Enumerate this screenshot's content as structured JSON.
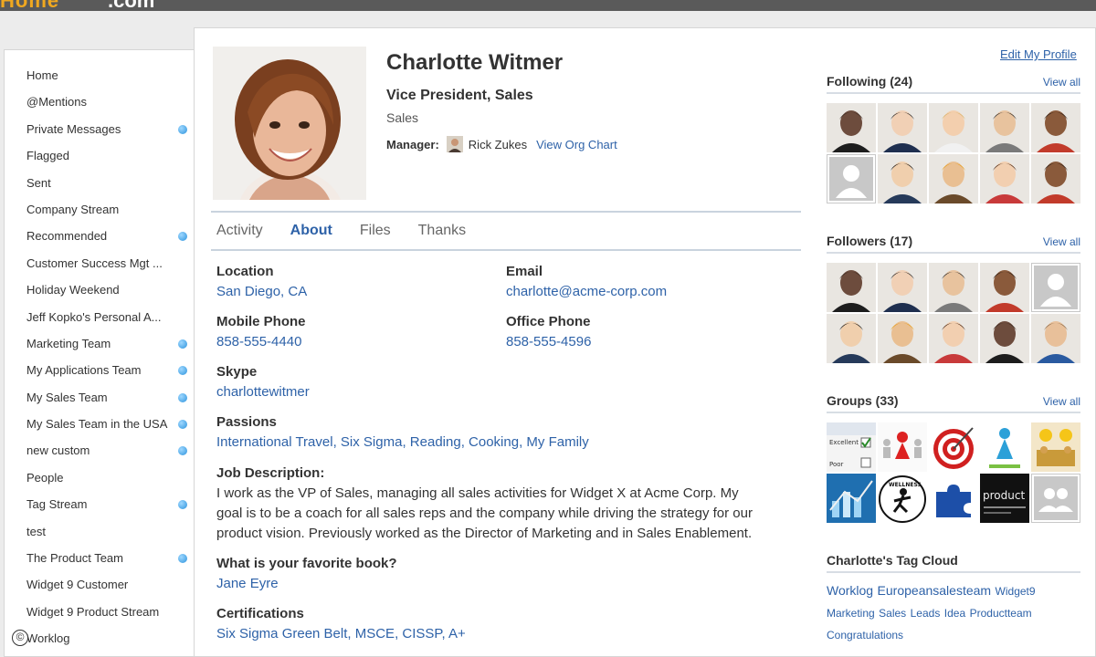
{
  "brand": {
    "left": "Home",
    "right": ".com"
  },
  "sidebar": {
    "items": [
      {
        "label": "Home",
        "dot": false
      },
      {
        "label": "@Mentions",
        "dot": false
      },
      {
        "label": "Private Messages",
        "dot": true
      },
      {
        "label": "Flagged",
        "dot": false
      },
      {
        "label": "Sent",
        "dot": false
      },
      {
        "label": "Company Stream",
        "dot": false
      },
      {
        "label": "Recommended",
        "dot": true
      },
      {
        "label": "Customer Success Mgt ...",
        "dot": false
      },
      {
        "label": "Holiday Weekend",
        "dot": false
      },
      {
        "label": "Jeff Kopko's Personal A...",
        "dot": false
      },
      {
        "label": "Marketing Team",
        "dot": true
      },
      {
        "label": "My Applications Team",
        "dot": true
      },
      {
        "label": "My Sales Team",
        "dot": true
      },
      {
        "label": "My Sales Team in the USA",
        "dot": true
      },
      {
        "label": "new custom",
        "dot": true
      },
      {
        "label": "People",
        "dot": false
      },
      {
        "label": "Tag Stream",
        "dot": true
      },
      {
        "label": "test",
        "dot": false
      },
      {
        "label": "The Product Team",
        "dot": true
      },
      {
        "label": "Widget 9 Customer",
        "dot": false
      },
      {
        "label": "Widget 9 Product Stream",
        "dot": false
      },
      {
        "label": "Worklog",
        "dot": false
      }
    ],
    "copyright": "©"
  },
  "profile": {
    "name": "Charlotte Witmer",
    "title": "Vice President, Sales",
    "department": "Sales",
    "manager_label": "Manager:",
    "manager_name": "Rick Zukes",
    "org_chart_link": "View Org Chart",
    "edit_link": "Edit My Profile"
  },
  "tabs": [
    {
      "label": "Activity",
      "active": false
    },
    {
      "label": "About",
      "active": true
    },
    {
      "label": "Files",
      "active": false
    },
    {
      "label": "Thanks",
      "active": false
    }
  ],
  "about": {
    "location_label": "Location",
    "location": "San Diego, CA",
    "email_label": "Email",
    "email": "charlotte@acme-corp.com",
    "mobile_label": "Mobile Phone",
    "mobile": "858-555-4440",
    "office_label": "Office Phone",
    "office": "858-555-4596",
    "skype_label": "Skype",
    "skype": "charlottewitmer",
    "passions_label": "Passions",
    "passions": [
      "International Travel",
      "Six Sigma",
      "Reading",
      "Cooking",
      "My Family"
    ],
    "jobdesc_label": "Job Description:",
    "jobdesc_lines": [
      "I work as the VP of Sales, managing all sales activities for Widget X at Acme Corp. My",
      "goal is to be a coach for all sales reps and the company while driving the strategy for our",
      "product vision. Previously worked as the Director of Marketing and in Sales Enablement."
    ],
    "book_label": "What is your favorite book?",
    "book": "Jane Eyre",
    "cert_label": "Certifications",
    "certs": "Six Sigma Green Belt, MSCE, CISSP, A+"
  },
  "following": {
    "title": "Following (24)",
    "view_all": "View all"
  },
  "followers": {
    "title": "Followers (17)",
    "view_all": "View all"
  },
  "groups": {
    "title": "Groups (33)",
    "view_all": "View all"
  },
  "group_thumb_text": {
    "excellent": "Excellent",
    "poor": "Poor",
    "wellness": "WELLNESS",
    "product": "product"
  },
  "tagcloud": {
    "title": "Charlotte's Tag Cloud",
    "tags": [
      {
        "text": "Worklog",
        "size": 14
      },
      {
        "text": "Europeansalesteam",
        "size": 14
      },
      {
        "text": "Widget9",
        "size": 12
      },
      {
        "text": "Marketing",
        "size": 12
      },
      {
        "text": "Sales",
        "size": 12
      },
      {
        "text": "Leads",
        "size": 12
      },
      {
        "text": "Idea",
        "size": 12
      },
      {
        "text": "Productteam",
        "size": 12
      },
      {
        "text": "Congratulations",
        "size": 12
      }
    ]
  },
  "colors": {
    "link": "#2e62a8",
    "accent_dot": "#2c93dd",
    "brand": "#f0a820"
  }
}
